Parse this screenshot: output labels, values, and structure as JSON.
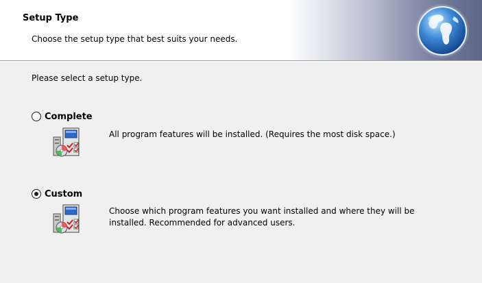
{
  "header": {
    "title": "Setup Type",
    "subtitle": "Choose the setup type that best suits your needs."
  },
  "main": {
    "prompt": "Please select a setup type.",
    "options": [
      {
        "label": "Complete",
        "description": "All program features will be installed. (Requires the most disk space.)",
        "selected": false,
        "icon": "setup-package-icon"
      },
      {
        "label": "Custom",
        "description": "Choose which program features you want installed and where they will be installed. Recommended for advanced users.",
        "selected": true,
        "icon": "setup-package-icon"
      }
    ]
  },
  "colors": {
    "background": "#f0f0f0",
    "banner_start": "#ffffff",
    "banner_end": "#5d6786",
    "globe_blue": "#2a6fc0",
    "checkmark_red": "#d42020"
  }
}
